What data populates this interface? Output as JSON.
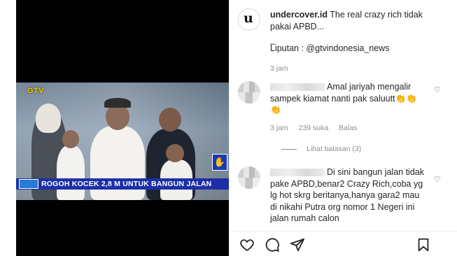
{
  "video": {
    "channel_logo": "GTV",
    "ticker_tag": "",
    "ticker_text": "ROGOH KOCEK 2,8 M UNTUK BANGUN JALAN",
    "sign_icon": "sign-language-icon"
  },
  "post": {
    "username": "undercover.id",
    "caption_line1": "The real crazy rich tidak",
    "caption_line2": "pakai APBD...",
    "caption_dash": "_",
    "caption_source": "Liputan : @gtvindonesia_news",
    "time": "3 jam",
    "avatar_letter": "u"
  },
  "comments": [
    {
      "text": "Amal jariyah mengalir sampek kiamat nanti pak saluutt👏👏👏",
      "time": "3 jam",
      "likes": "239 suka",
      "reply_label": "Balas",
      "view_replies": "Lihat balasan (3)"
    },
    {
      "text": "Di sini bangun jalan tidak pake APBD,benar2 Crazy Rich,coba yg lg hot skrg beritanya,hanya gara2 mau di nikahi Putra org nomor 1 Negeri ini jalan rumah calon"
    }
  ],
  "actions": {
    "like_icon": "heart-icon",
    "comment_icon": "comment-icon",
    "share_icon": "share-icon",
    "save_icon": "bookmark-icon"
  }
}
